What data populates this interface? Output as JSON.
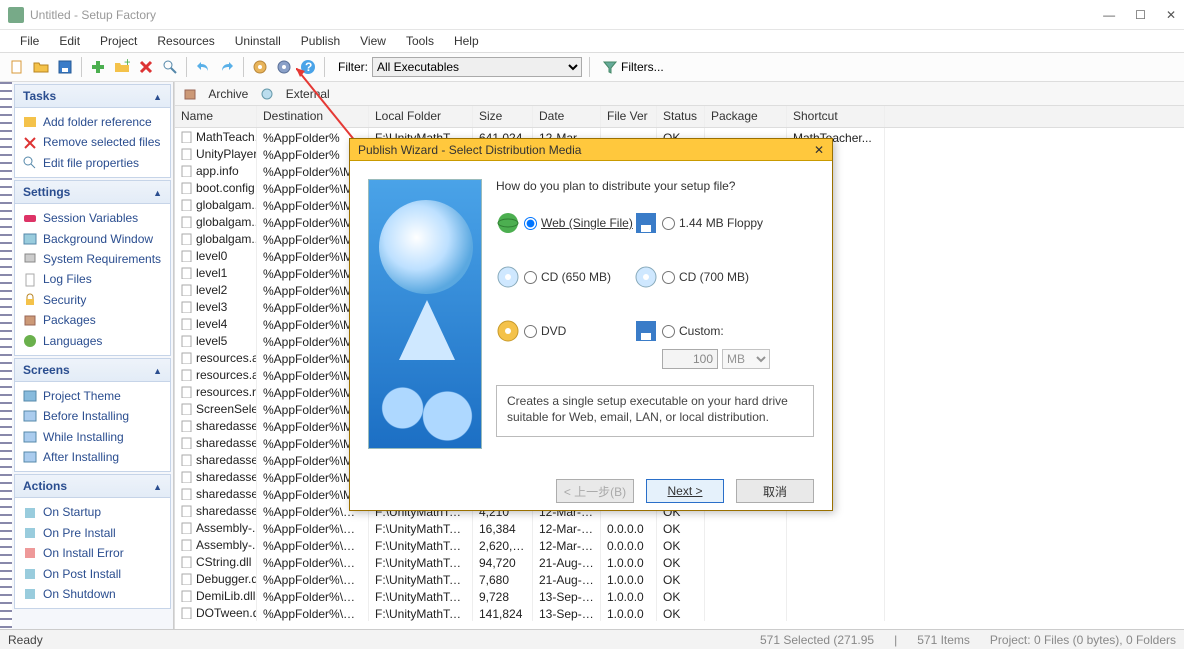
{
  "window": {
    "title": "Untitled - Setup Factory",
    "min": "—",
    "max": "☐",
    "close": "✕"
  },
  "menubar": [
    "File",
    "Edit",
    "Project",
    "Resources",
    "Uninstall",
    "Publish",
    "View",
    "Tools",
    "Help"
  ],
  "toolbar": {
    "filter_label": "Filter:",
    "filter_value": "All Executables",
    "filters_btn": "Filters..."
  },
  "tabs": {
    "archive": "Archive",
    "external": "External"
  },
  "sidebar": {
    "tasks": {
      "title": "Tasks",
      "items": [
        "Add folder reference",
        "Remove selected files",
        "Edit file properties"
      ]
    },
    "settings": {
      "title": "Settings",
      "items": [
        "Session Variables",
        "Background Window",
        "System Requirements",
        "Log Files",
        "Security",
        "Packages",
        "Languages"
      ]
    },
    "screens": {
      "title": "Screens",
      "items": [
        "Project Theme",
        "Before Installing",
        "While Installing",
        "After Installing"
      ]
    },
    "actions": {
      "title": "Actions",
      "items": [
        "On Startup",
        "On Pre Install",
        "On Install Error",
        "On Post Install",
        "On Shutdown"
      ]
    }
  },
  "grid": {
    "headers": [
      "Name",
      "Destination",
      "Local Folder",
      "Size",
      "Date",
      "File Ver",
      "Status",
      "Package",
      "Shortcut"
    ],
    "rows": [
      {
        "name": "MathTeach...",
        "dest": "%AppFolder%",
        "folder": "F:\\UnityMathTeac...",
        "size": "641,024",
        "date": "12-Mar-2...",
        "ver": "",
        "status": "OK",
        "pkg": "",
        "short": "MathTeacher..."
      },
      {
        "name": "UnityPlayer...",
        "dest": "%AppFolder%",
        "folder": "",
        "size": "",
        "date": "",
        "ver": "",
        "status": "",
        "pkg": "",
        "short": ""
      },
      {
        "name": "app.info",
        "dest": "%AppFolder%\\M",
        "folder": "",
        "size": "",
        "date": "",
        "ver": "",
        "status": "",
        "pkg": "",
        "short": ""
      },
      {
        "name": "boot.config",
        "dest": "%AppFolder%\\M",
        "folder": "",
        "size": "",
        "date": "",
        "ver": "",
        "status": "",
        "pkg": "",
        "short": ""
      },
      {
        "name": "globalgam...",
        "dest": "%AppFolder%\\M",
        "folder": "",
        "size": "",
        "date": "",
        "ver": "",
        "status": "",
        "pkg": "",
        "short": ""
      },
      {
        "name": "globalgam...",
        "dest": "%AppFolder%\\M",
        "folder": "",
        "size": "",
        "date": "",
        "ver": "",
        "status": "",
        "pkg": "",
        "short": ""
      },
      {
        "name": "globalgam...",
        "dest": "%AppFolder%\\M",
        "folder": "",
        "size": "",
        "date": "",
        "ver": "",
        "status": "",
        "pkg": "",
        "short": ""
      },
      {
        "name": "level0",
        "dest": "%AppFolder%\\M",
        "folder": "",
        "size": "",
        "date": "",
        "ver": "",
        "status": "",
        "pkg": "",
        "short": ""
      },
      {
        "name": "level1",
        "dest": "%AppFolder%\\M",
        "folder": "",
        "size": "",
        "date": "",
        "ver": "",
        "status": "",
        "pkg": "",
        "short": ""
      },
      {
        "name": "level2",
        "dest": "%AppFolder%\\M",
        "folder": "",
        "size": "",
        "date": "",
        "ver": "",
        "status": "",
        "pkg": "",
        "short": ""
      },
      {
        "name": "level3",
        "dest": "%AppFolder%\\M",
        "folder": "",
        "size": "",
        "date": "",
        "ver": "",
        "status": "",
        "pkg": "",
        "short": ""
      },
      {
        "name": "level4",
        "dest": "%AppFolder%\\M",
        "folder": "",
        "size": "",
        "date": "",
        "ver": "",
        "status": "",
        "pkg": "",
        "short": ""
      },
      {
        "name": "level5",
        "dest": "%AppFolder%\\M",
        "folder": "",
        "size": "",
        "date": "",
        "ver": "",
        "status": "",
        "pkg": "",
        "short": ""
      },
      {
        "name": "resources.a...",
        "dest": "%AppFolder%\\M",
        "folder": "",
        "size": "",
        "date": "",
        "ver": "",
        "status": "",
        "pkg": "",
        "short": ""
      },
      {
        "name": "resources.a...",
        "dest": "%AppFolder%\\M",
        "folder": "",
        "size": "",
        "date": "",
        "ver": "",
        "status": "",
        "pkg": "",
        "short": ""
      },
      {
        "name": "resources.r...",
        "dest": "%AppFolder%\\M",
        "folder": "",
        "size": "",
        "date": "",
        "ver": "",
        "status": "",
        "pkg": "",
        "short": ""
      },
      {
        "name": "ScreenSele...",
        "dest": "%AppFolder%\\M",
        "folder": "",
        "size": "",
        "date": "",
        "ver": "",
        "status": "",
        "pkg": "",
        "short": ""
      },
      {
        "name": "sharedasse...",
        "dest": "%AppFolder%\\M",
        "folder": "",
        "size": "",
        "date": "",
        "ver": "",
        "status": "",
        "pkg": "",
        "short": ""
      },
      {
        "name": "sharedasse...",
        "dest": "%AppFolder%\\M",
        "folder": "",
        "size": "",
        "date": "",
        "ver": "",
        "status": "",
        "pkg": "",
        "short": ""
      },
      {
        "name": "sharedasse...",
        "dest": "%AppFolder%\\M",
        "folder": "",
        "size": "",
        "date": "",
        "ver": "",
        "status": "",
        "pkg": "",
        "short": ""
      },
      {
        "name": "sharedasse...",
        "dest": "%AppFolder%\\M",
        "folder": "",
        "size": "",
        "date": "",
        "ver": "",
        "status": "",
        "pkg": "",
        "short": ""
      },
      {
        "name": "sharedasse...",
        "dest": "%AppFolder%\\M",
        "folder": "",
        "size": "",
        "date": "",
        "ver": "",
        "status": "",
        "pkg": "",
        "short": ""
      },
      {
        "name": "sharedasse...",
        "dest": "%AppFolder%\\Mat...",
        "folder": "F:\\UnityMathTeac...",
        "size": "4,210",
        "date": "12-Mar-2...",
        "ver": "",
        "status": "OK",
        "pkg": "",
        "short": ""
      },
      {
        "name": "Assembly-...",
        "dest": "%AppFolder%\\Mat...",
        "folder": "F:\\UnityMathTeac...",
        "size": "16,384",
        "date": "12-Mar-2...",
        "ver": "0.0.0.0",
        "status": "OK",
        "pkg": "",
        "short": ""
      },
      {
        "name": "Assembly-...",
        "dest": "%AppFolder%\\Mat...",
        "folder": "F:\\UnityMathTeac...",
        "size": "2,620,928",
        "date": "12-Mar-2...",
        "ver": "0.0.0.0",
        "status": "OK",
        "pkg": "",
        "short": ""
      },
      {
        "name": "CString.dll",
        "dest": "%AppFolder%\\Mat...",
        "folder": "F:\\UnityMathTeac...",
        "size": "94,720",
        "date": "21-Aug-20...",
        "ver": "1.0.0.0",
        "status": "OK",
        "pkg": "",
        "short": ""
      },
      {
        "name": "Debugger.dll",
        "dest": "%AppFolder%\\Mat...",
        "folder": "F:\\UnityMathTeac...",
        "size": "7,680",
        "date": "21-Aug-20...",
        "ver": "1.0.0.0",
        "status": "OK",
        "pkg": "",
        "short": ""
      },
      {
        "name": "DemiLib.dll",
        "dest": "%AppFolder%\\Mat...",
        "folder": "F:\\UnityMathTeac...",
        "size": "9,728",
        "date": "13-Sep-20...",
        "ver": "1.0.0.0",
        "status": "OK",
        "pkg": "",
        "short": ""
      },
      {
        "name": "DOTween.dll",
        "dest": "%AppFolder%\\Mat...",
        "folder": "F:\\UnityMathTeac...",
        "size": "141,824",
        "date": "13-Sep-20...",
        "ver": "1.0.0.0",
        "status": "OK",
        "pkg": "",
        "short": ""
      }
    ]
  },
  "statusbar": {
    "ready": "Ready",
    "selected": "571 Selected (271.95",
    "items": "571 Items",
    "project": "Project: 0 Files (0 bytes), 0 Folders"
  },
  "dialog": {
    "title": "Publish Wizard - Select Distribution Media",
    "question": "How do you plan to distribute your setup file?",
    "opts": {
      "web": "Web (Single File)",
      "floppy": "1.44 MB Floppy",
      "cd650": "CD (650 MB)",
      "cd700": "CD (700 MB)",
      "dvd": "DVD",
      "custom": "Custom:"
    },
    "custom_size": "100",
    "custom_unit": "MB",
    "desc": "Creates a single setup executable on your hard drive suitable for Web, email, LAN, or local distribution.",
    "back": "< 上一步(B)",
    "next": "Next >",
    "cancel": "取消"
  }
}
